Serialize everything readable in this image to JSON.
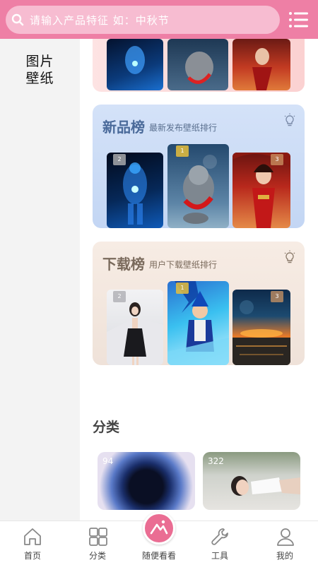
{
  "header": {
    "search_placeholder": "请输入产品特征 如：中秋节",
    "menu_icon": "list-icon"
  },
  "sidebar": {
    "items": [
      {
        "label": "图片\n壁纸",
        "line1": "图片",
        "line2": "壁纸"
      }
    ]
  },
  "sections": {
    "new": {
      "title": "新品榜",
      "subtitle": "最新发布壁纸排行",
      "ranks": [
        "2",
        "1",
        "3"
      ]
    },
    "download": {
      "title": "下载榜",
      "subtitle": "用户下载壁纸排行",
      "ranks": [
        "2",
        "1",
        "3"
      ]
    }
  },
  "category": {
    "title": "分类",
    "items": [
      {
        "count": "94"
      },
      {
        "count": "322"
      }
    ]
  },
  "bottom_nav": {
    "items": [
      {
        "label": "首页",
        "icon": "home-icon"
      },
      {
        "label": "分类",
        "icon": "grid-icon"
      },
      {
        "label": "随便看看",
        "icon": "mountain-icon"
      },
      {
        "label": "工具",
        "icon": "wrench-icon"
      },
      {
        "label": "我的",
        "icon": "user-icon"
      }
    ]
  },
  "colors": {
    "accent": "#ee7fa5",
    "center_button": "#ea6d93"
  }
}
